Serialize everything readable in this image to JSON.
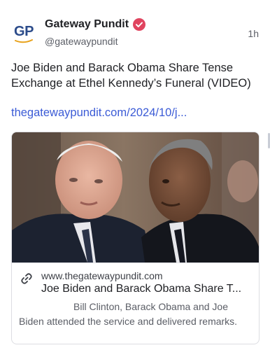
{
  "post": {
    "author": {
      "display_name": "Gateway Pundit",
      "handle": "@gatewaypundit",
      "avatar_initials": "GP",
      "verified": true
    },
    "timestamp": "1h",
    "text": "Joe Biden and Barack Obama Share Tense Exchange at Ethel Kennedy’s Funeral (VIDEO)",
    "link_text": "thegatewaypundit.com/2024/10/j..."
  },
  "embed": {
    "domain": "www.thegatewaypundit.com",
    "title": "Joe Biden and Barack Obama Share T...",
    "description": "Bill Clinton, Barack Obama and Joe Biden attended the service and delivered remarks.",
    "link_icon": "link-icon"
  },
  "colors": {
    "accent_link": "#3b5bd6",
    "verified_badge": "#e0445f",
    "avatar_brand": "#2b4b8a",
    "avatar_swoosh": "#e8a21a"
  }
}
